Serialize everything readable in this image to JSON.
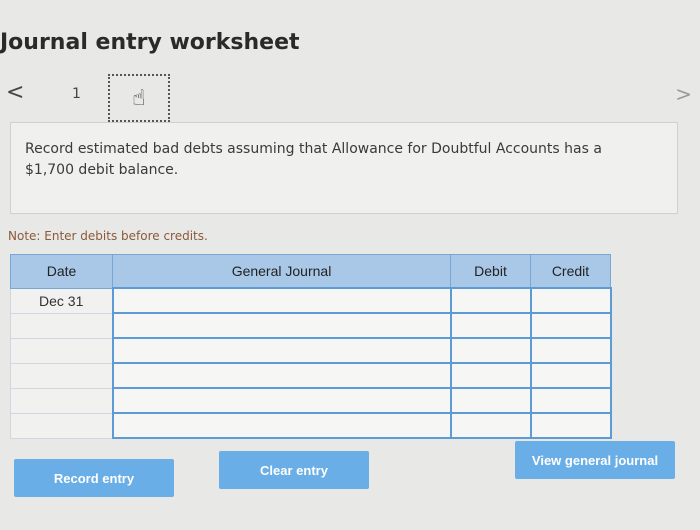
{
  "header": {
    "title": "Journal entry worksheet"
  },
  "nav": {
    "prev": "<",
    "next": ">",
    "step": "1"
  },
  "prompt": "Record estimated bad debts assuming that Allowance for Doubtful Accounts has a $1,700 debit balance.",
  "note": "Note: Enter debits before credits.",
  "table": {
    "headers": {
      "date": "Date",
      "account": "General Journal",
      "debit": "Debit",
      "credit": "Credit"
    },
    "rows": [
      {
        "date": "Dec 31",
        "account": "",
        "debit": "",
        "credit": ""
      },
      {
        "date": "",
        "account": "",
        "debit": "",
        "credit": ""
      },
      {
        "date": "",
        "account": "",
        "debit": "",
        "credit": ""
      },
      {
        "date": "",
        "account": "",
        "debit": "",
        "credit": ""
      },
      {
        "date": "",
        "account": "",
        "debit": "",
        "credit": ""
      },
      {
        "date": "",
        "account": "",
        "debit": "",
        "credit": ""
      }
    ]
  },
  "buttons": {
    "record": "Record entry",
    "clear": "Clear entry",
    "view": "View general journal"
  },
  "colors": {
    "button": "#69aee6",
    "header": "#a9c8e8",
    "input_border": "#5c9bd6"
  }
}
